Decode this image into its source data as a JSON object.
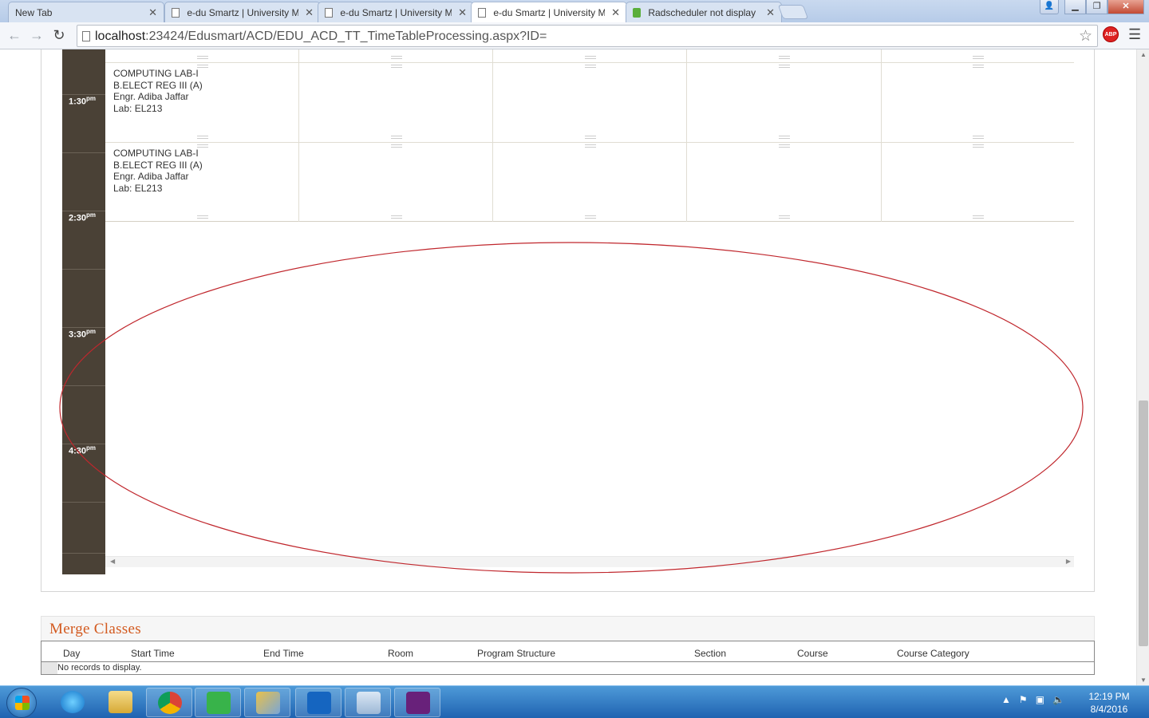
{
  "browser": {
    "tabs": [
      {
        "title": "New Tab",
        "active": false
      },
      {
        "title": "e-du Smartz | University M",
        "active": false
      },
      {
        "title": "e-du Smartz | University M",
        "active": false
      },
      {
        "title": "e-du Smartz | University M",
        "active": true
      },
      {
        "title": "Radscheduler not display",
        "active": false
      }
    ],
    "url_host": "localhost",
    "url_rest": ":23424/Edusmart/ACD/EDU_ACD_TT_TimeTableProcessing.aspx?ID=",
    "abp_label": "ABP"
  },
  "scheduler": {
    "times": [
      {
        "label": "1:30",
        "suffix": "pm"
      },
      {
        "label": "2:30",
        "suffix": "pm"
      },
      {
        "label": "3:30",
        "suffix": "pm"
      },
      {
        "label": "4:30",
        "suffix": "pm"
      }
    ],
    "appointments": [
      {
        "course": "COMPUTING LAB-I",
        "program": "B.ELECT REG III (A)",
        "teacher": "Engr. Adiba Jaffar",
        "room": "Lab: EL213"
      },
      {
        "course": "COMPUTING LAB-I",
        "program": "B.ELECT REG III (A)",
        "teacher": "Engr. Adiba Jaffar",
        "room": "Lab: EL213"
      }
    ],
    "annotation_color": "#c0272d"
  },
  "merge": {
    "title": "Merge Classes",
    "columns": [
      "Day",
      "Start Time",
      "End Time",
      "Room",
      "Program Structure",
      "Section",
      "Course",
      "Course Category"
    ],
    "empty_message": "No records to display."
  },
  "taskbar": {
    "clock_time": "12:19 PM",
    "clock_date": "8/4/2016"
  }
}
